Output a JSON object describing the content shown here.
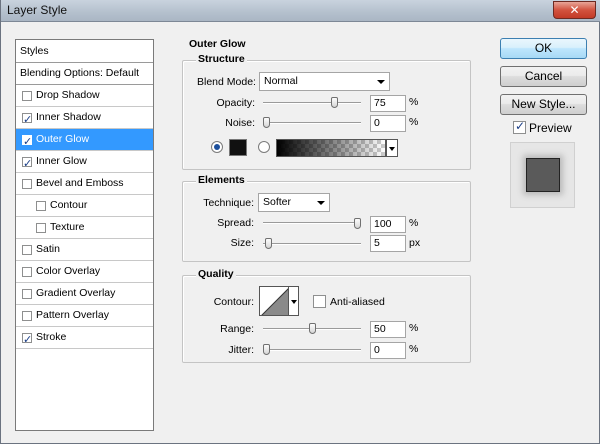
{
  "window": {
    "title": "Layer Style",
    "close_glyph": "✕"
  },
  "styles_list": {
    "header": "Styles",
    "items": [
      {
        "label": "Blending Options: Default",
        "checkbox": false,
        "checked": false,
        "selected": false,
        "indent": 0
      },
      {
        "label": "Drop Shadow",
        "checkbox": true,
        "checked": false,
        "selected": false,
        "indent": 0
      },
      {
        "label": "Inner Shadow",
        "checkbox": true,
        "checked": true,
        "selected": false,
        "indent": 0
      },
      {
        "label": "Outer Glow",
        "checkbox": true,
        "checked": true,
        "selected": true,
        "indent": 0
      },
      {
        "label": "Inner Glow",
        "checkbox": true,
        "checked": true,
        "selected": false,
        "indent": 0
      },
      {
        "label": "Bevel and Emboss",
        "checkbox": true,
        "checked": false,
        "selected": false,
        "indent": 0
      },
      {
        "label": "Contour",
        "checkbox": true,
        "checked": false,
        "selected": false,
        "indent": 1
      },
      {
        "label": "Texture",
        "checkbox": true,
        "checked": false,
        "selected": false,
        "indent": 1
      },
      {
        "label": "Satin",
        "checkbox": true,
        "checked": false,
        "selected": false,
        "indent": 0
      },
      {
        "label": "Color Overlay",
        "checkbox": true,
        "checked": false,
        "selected": false,
        "indent": 0
      },
      {
        "label": "Gradient Overlay",
        "checkbox": true,
        "checked": false,
        "selected": false,
        "indent": 0
      },
      {
        "label": "Pattern Overlay",
        "checkbox": true,
        "checked": false,
        "selected": false,
        "indent": 0
      },
      {
        "label": "Stroke",
        "checkbox": true,
        "checked": true,
        "selected": false,
        "indent": 0
      }
    ]
  },
  "outer_glow": {
    "title": "Outer Glow",
    "structure": {
      "title": "Structure",
      "blend_mode_label": "Blend Mode:",
      "blend_mode_value": "Normal",
      "opacity_label": "Opacity:",
      "opacity_value": "75",
      "opacity_unit": "%",
      "opacity_fraction": 0.75,
      "noise_label": "Noise:",
      "noise_value": "0",
      "noise_unit": "%",
      "noise_fraction": 0.0,
      "color_mode": "solid",
      "glow_color": "#111111"
    },
    "elements": {
      "title": "Elements",
      "technique_label": "Technique:",
      "technique_value": "Softer",
      "spread_label": "Spread:",
      "spread_value": "100",
      "spread_unit": "%",
      "spread_fraction": 1.0,
      "size_label": "Size:",
      "size_value": "5",
      "size_unit": "px",
      "size_fraction": 0.02
    },
    "quality": {
      "title": "Quality",
      "contour_label": "Contour:",
      "anti_aliased_label": "Anti-aliased",
      "anti_aliased": false,
      "range_label": "Range:",
      "range_value": "50",
      "range_unit": "%",
      "range_fraction": 0.5,
      "jitter_label": "Jitter:",
      "jitter_value": "0",
      "jitter_unit": "%",
      "jitter_fraction": 0.0
    }
  },
  "buttons": {
    "ok": "OK",
    "cancel": "Cancel",
    "new_style": "New Style...",
    "preview_label": "Preview",
    "preview_checked": true
  },
  "colors": {
    "selection": "#3399ff",
    "checkmark": "#1a3d86"
  }
}
